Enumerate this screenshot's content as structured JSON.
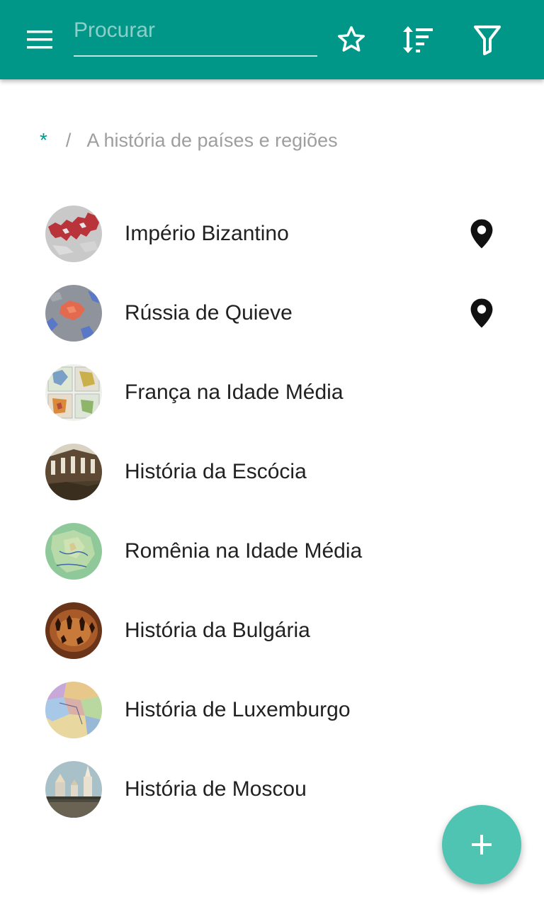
{
  "toolbar": {
    "menu_icon": "menu-icon",
    "search_placeholder": "Procurar",
    "search_value": "",
    "favorites_icon": "star-outline-icon",
    "sort_icon": "sort-icon",
    "filter_icon": "filter-icon",
    "background_color": "#009688"
  },
  "breadcrumb": {
    "root": "*",
    "separator": "/",
    "current": "A história de países e regiões"
  },
  "items": [
    {
      "label": "Império Bizantino",
      "thumbnail": "byzantine-map-thumbnail",
      "has_location": true
    },
    {
      "label": "Rússia de Quieve",
      "thumbnail": "kievan-rus-map-thumbnail",
      "has_location": true
    },
    {
      "label": "França na Idade Média",
      "thumbnail": "medieval-france-maps-thumbnail",
      "has_location": false
    },
    {
      "label": "História da Escócia",
      "thumbnail": "scottish-ruins-thumbnail",
      "has_location": false
    },
    {
      "label": "Romênia na Idade Média",
      "thumbnail": "romania-relief-map-thumbnail",
      "has_location": false
    },
    {
      "label": "História da Bulgária",
      "thumbnail": "cave-paintings-thumbnail",
      "has_location": false
    },
    {
      "label": "História de Luxemburgo",
      "thumbnail": "luxembourg-map-thumbnail",
      "has_location": false
    },
    {
      "label": "História de Moscou",
      "thumbnail": "moscow-cathedral-thumbnail",
      "has_location": false
    }
  ],
  "fab": {
    "icon": "plus-icon",
    "color": "#4fc4b3"
  }
}
